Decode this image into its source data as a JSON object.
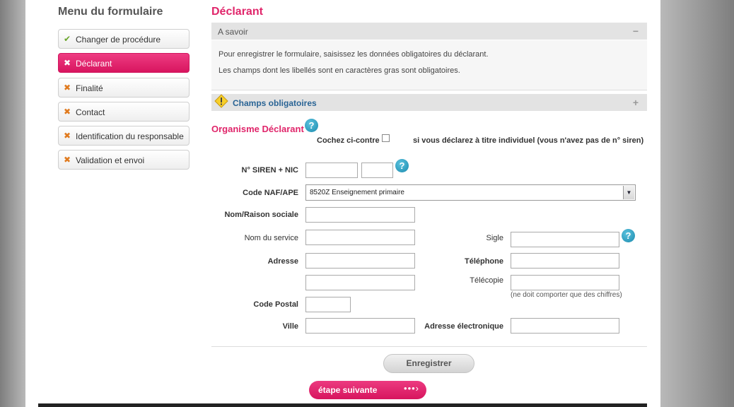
{
  "sidebar": {
    "title": "Menu du formulaire",
    "items": [
      {
        "label": "Changer de procédure",
        "icon": "✔"
      },
      {
        "label": "Déclarant",
        "icon": "✖"
      },
      {
        "label": "Finalité",
        "icon": "✖"
      },
      {
        "label": "Contact",
        "icon": "✖"
      },
      {
        "label": "Identification du responsable",
        "icon": "✖"
      },
      {
        "label": "Validation et envoi",
        "icon": "✖"
      }
    ],
    "active_item": "Déclarant"
  },
  "main": {
    "title": "Déclarant",
    "a_savoir": {
      "label": "A savoir",
      "toggle": "−",
      "lines": [
        "Pour enregistrer le formulaire, saisissez les données obligatoires du déclarant.",
        "Les champs dont les libellés sont en caractères gras sont obligatoires."
      ]
    },
    "champs": {
      "label": "Champs obligatoires",
      "toggle": "+"
    },
    "organisme": {
      "title": "Organisme Déclarant",
      "cochez": "Cochez ci-contre",
      "individuel": "si vous déclarez à titre individuel (vous n'avez pas de n° siren)"
    }
  },
  "form": {
    "siren_label": "N° SIREN + NIC",
    "naf_label": "Code NAF/APE",
    "naf_value": "8520Z Enseignement primaire",
    "nom_label": "Nom/Raison sociale",
    "service_label": "Nom du service",
    "sigle_label": "Sigle",
    "adresse_label": "Adresse",
    "telephone_label": "Téléphone",
    "telecopie_label": "Télécopie",
    "telecopie_hint": "(ne doit comporter que des chiffres)",
    "cp_label": "Code Postal",
    "ville_label": "Ville",
    "email_label": "Adresse électronique"
  },
  "help_glyph": "?",
  "buttons": {
    "save": "Enregistrer",
    "next": "étape suivante",
    "next_icon": "•••›"
  },
  "colors": {
    "accent": "#e0256a",
    "link_blue": "#2a6495",
    "help": "#1b8aad",
    "check": "#6aa52a",
    "cross": "#e07a1e"
  }
}
